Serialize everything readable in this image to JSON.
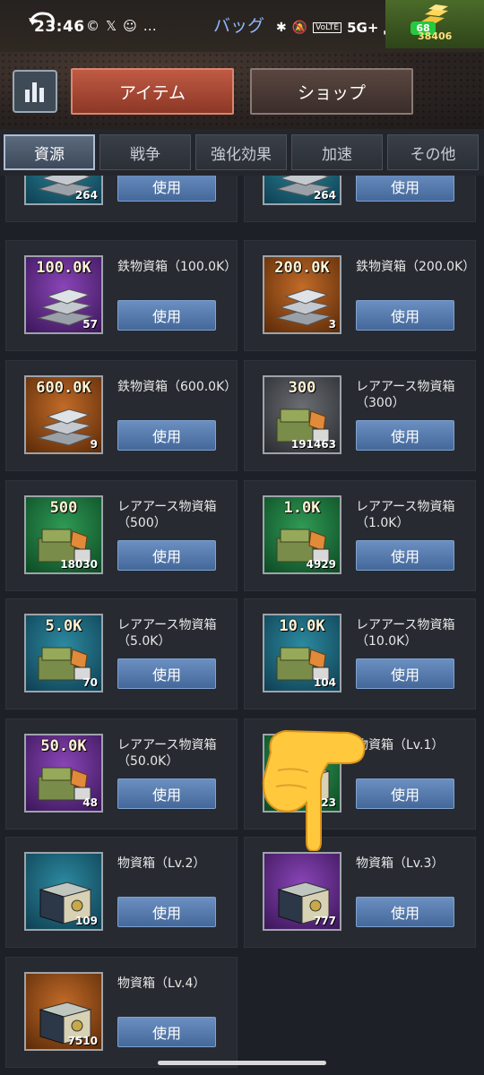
{
  "status_bar": {
    "time": "23:46",
    "notif_icons": [
      "©",
      "𝕏",
      "☺",
      "…"
    ],
    "title": "バッグ",
    "network": "5G+",
    "battery": "68",
    "gold_count": "38406"
  },
  "header": {
    "tabs": [
      {
        "label": "アイテム",
        "active": true
      },
      {
        "label": "ショップ",
        "active": false
      }
    ]
  },
  "subtabs": [
    {
      "label": "資源",
      "active": true
    },
    {
      "label": "戦争",
      "active": false
    },
    {
      "label": "強化効果",
      "active": false
    },
    {
      "label": "加速",
      "active": false
    },
    {
      "label": "その他",
      "active": false
    }
  ],
  "use_label": "使用",
  "items": [
    {
      "title": "",
      "badge": "",
      "count": "264",
      "bg": "blue",
      "art": "steel"
    },
    {
      "title": "",
      "badge": "",
      "count": "264",
      "bg": "blue",
      "art": "steel"
    },
    {
      "title": "鉄物資箱（100.0K）",
      "badge": "100.0K",
      "count": "57",
      "bg": "purple",
      "art": "steel"
    },
    {
      "title": "鉄物資箱（200.0K）",
      "badge": "200.0K",
      "count": "3",
      "bg": "orange",
      "art": "steel"
    },
    {
      "title": "鉄物資箱（600.0K）",
      "badge": "600.0K",
      "count": "9",
      "bg": "orange",
      "art": "steel"
    },
    {
      "title": "レアアース物資箱（300）",
      "badge": "300",
      "count": "191463",
      "bg": "gray",
      "art": "rare"
    },
    {
      "title": "レアアース物資箱（500）",
      "badge": "500",
      "count": "18030",
      "bg": "green",
      "art": "rare"
    },
    {
      "title": "レアアース物資箱（1.0K）",
      "badge": "1.0K",
      "count": "4929",
      "bg": "green",
      "art": "rare"
    },
    {
      "title": "レアアース物資箱（5.0K）",
      "badge": "5.0K",
      "count": "70",
      "bg": "blue",
      "art": "rare"
    },
    {
      "title": "レアアース物資箱（10.0K）",
      "badge": "10.0K",
      "count": "104",
      "bg": "blue",
      "art": "rare"
    },
    {
      "title": "レアアース物資箱（50.0K）",
      "badge": "50.0K",
      "count": "48",
      "bg": "purple",
      "art": "rare"
    },
    {
      "title": "物資箱（Lv.1）",
      "badge": "",
      "count": "23",
      "bg": "green",
      "art": "chest"
    },
    {
      "title": "物資箱（Lv.2）",
      "badge": "",
      "count": "109",
      "bg": "blue",
      "art": "chest"
    },
    {
      "title": "物資箱（Lv.3）",
      "badge": "",
      "count": "777",
      "bg": "purple",
      "art": "chest"
    },
    {
      "title": "物資箱（Lv.4）",
      "badge": "",
      "count": "7510",
      "bg": "orange",
      "art": "chest"
    }
  ]
}
